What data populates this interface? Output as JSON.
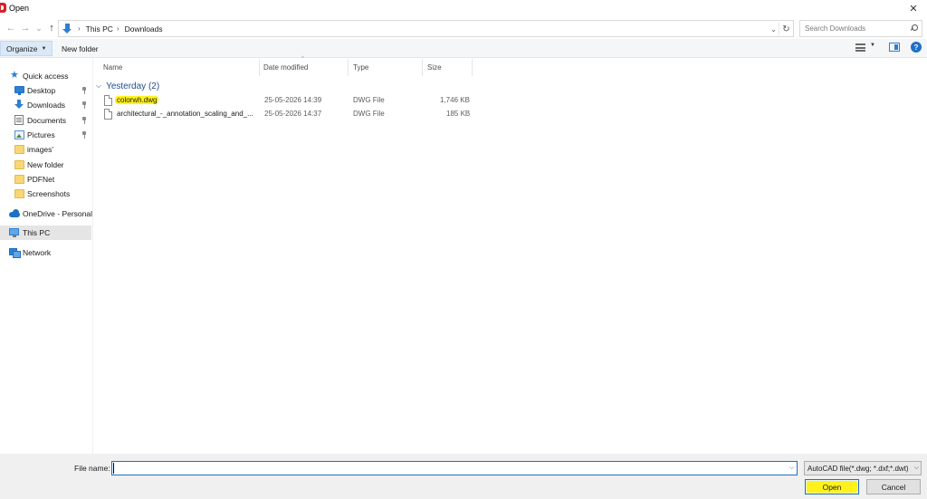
{
  "window": {
    "title": "Open",
    "close_glyph": "✕"
  },
  "nav": {
    "back_glyph": "←",
    "forward_glyph": "→",
    "recent_glyph": "⌄",
    "up_glyph": "↑",
    "breadcrumbs": [
      "This PC",
      "Downloads"
    ],
    "separator": "›",
    "search_placeholder": "Search Downloads"
  },
  "toolbar": {
    "organize_label": "Organize",
    "new_folder_label": "New folder"
  },
  "sidebar": {
    "items": [
      {
        "label": "Quick access",
        "icon": "star-icon"
      },
      {
        "label": "Desktop",
        "icon": "desktop-icon",
        "pinned": true
      },
      {
        "label": "Downloads",
        "icon": "download-icon",
        "pinned": true
      },
      {
        "label": "Documents",
        "icon": "documents-icon",
        "pinned": true
      },
      {
        "label": "Pictures",
        "icon": "pictures-icon",
        "pinned": true
      },
      {
        "label": "images'",
        "icon": "folder-icon"
      },
      {
        "label": "New folder",
        "icon": "folder-icon"
      },
      {
        "label": "PDFNet",
        "icon": "folder-icon"
      },
      {
        "label": "Screenshots",
        "icon": "folder-icon"
      },
      {
        "label": "OneDrive - Personal",
        "icon": "cloud-icon"
      },
      {
        "label": "This PC",
        "icon": "computer-icon",
        "selected": true
      },
      {
        "label": "Network",
        "icon": "network-icon"
      }
    ]
  },
  "columns": {
    "name": "Name",
    "date": "Date modified",
    "type": "Type",
    "size": "Size"
  },
  "group": {
    "label": "Yesterday (2)"
  },
  "files": [
    {
      "name": "colorwh.dwg",
      "date": "25-05-2026 14:39",
      "type": "DWG File",
      "size": "1,746 KB",
      "highlighted": true
    },
    {
      "name": "architectural_-_annotation_scaling_and_...",
      "date": "25-05-2026 14:37",
      "type": "DWG File",
      "size": "185 KB",
      "highlighted": false
    }
  ],
  "bottom": {
    "file_name_label": "File name:",
    "file_name_value": "",
    "file_type": "AutoCAD file(*.dwg; *.dxf;*.dwt)",
    "open_label": "Open",
    "cancel_label": "Cancel"
  },
  "colors": {
    "accent": "#1f6fc5",
    "highlight": "#fff21a",
    "group_text": "#1f4e8c"
  }
}
